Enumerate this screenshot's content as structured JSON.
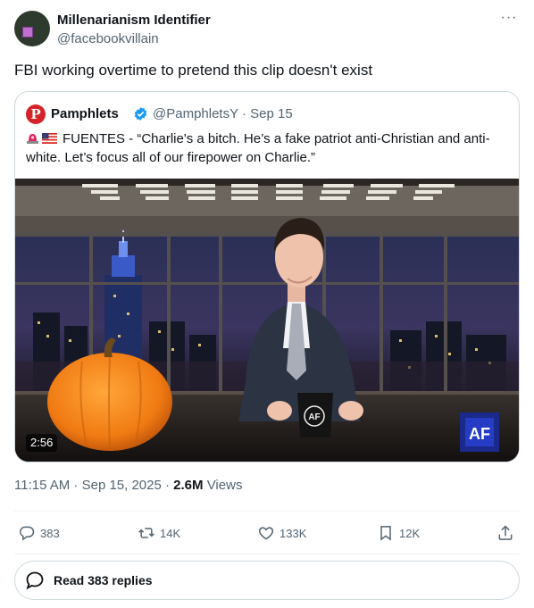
{
  "author": {
    "name": "Millenarianism Identifier",
    "handle": "@facebookvillain"
  },
  "more_glyph": "···",
  "tweet_text": "FBI working overtime to pretend this clip doesn't exist",
  "quote": {
    "avatar_letter": "P",
    "name": "Pamphlets",
    "handle_date": "@PamphletsY · Sep 15",
    "text": "FUENTES - “Charlie's a bitch. He’s a fake patriot anti-Christian and anti-white. Let’s focus all of our firepower on Charlie.”",
    "video_duration": "2:56",
    "video_logo": "AF",
    "mug_logo": "AF"
  },
  "meta": {
    "time_date": "11:15 AM · Sep 15, 2025 · ",
    "views_count": "2.6M",
    "views_label": " Views"
  },
  "actions": {
    "replies": "383",
    "reposts": "14K",
    "likes": "133K",
    "bookmarks": "12K"
  },
  "read_replies": "Read 383 replies",
  "colors": {
    "accent": "#1d9bf0",
    "text": "#0f1419",
    "muted": "#536471",
    "border": "#cfd9de",
    "brand_red": "#d6222a"
  }
}
